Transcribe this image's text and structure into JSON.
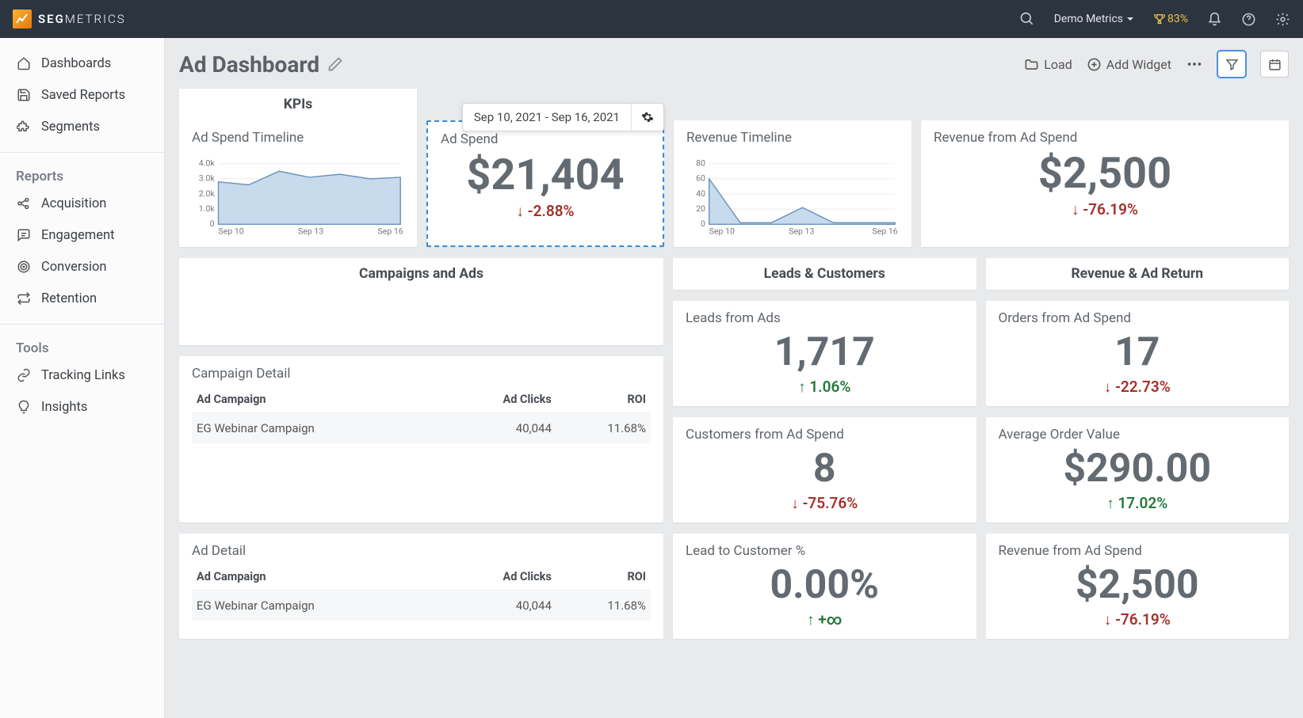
{
  "brand": {
    "seg": "SEG",
    "metrics": "METRICS"
  },
  "topbar": {
    "account": "Demo Metrics",
    "trophy_pct": "83%"
  },
  "sidebar": {
    "items_main": [
      {
        "label": "Dashboards"
      },
      {
        "label": "Saved Reports"
      },
      {
        "label": "Segments"
      }
    ],
    "reports_head": "Reports",
    "items_reports": [
      {
        "label": "Acquisition"
      },
      {
        "label": "Engagement"
      },
      {
        "label": "Conversion"
      },
      {
        "label": "Retention"
      }
    ],
    "tools_head": "Tools",
    "items_tools": [
      {
        "label": "Tracking Links"
      },
      {
        "label": "Insights"
      }
    ]
  },
  "page": {
    "title": "Ad Dashboard",
    "load": "Load",
    "add_widget": "Add Widget"
  },
  "kpis_label": "KPIs",
  "date_range": "Sep 10, 2021 - Sep 16, 2021",
  "ad_spend_timeline": {
    "title": "Ad Spend Timeline"
  },
  "ad_spend": {
    "title": "Ad Spend",
    "value": "$21,404",
    "delta": "↓ -2.88%"
  },
  "revenue_timeline": {
    "title": "Revenue Timeline"
  },
  "revenue_from_ad_spend": {
    "title": "Revenue from Ad Spend",
    "value": "$2,500",
    "delta": "↓ -76.19%"
  },
  "section_campaigns": "Campaigns and Ads",
  "section_leads": "Leads & Customers",
  "section_revret": "Revenue & Ad Return",
  "campaign_detail": {
    "title": "Campaign Detail",
    "cols": {
      "c1": "Ad Campaign",
      "c2": "Ad Clicks",
      "c3": "ROI"
    },
    "row": {
      "c1": "EG Webinar Campaign",
      "c2": "40,044",
      "c3": "11.68%"
    }
  },
  "ad_detail": {
    "title": "Ad Detail",
    "cols": {
      "c1": "Ad Campaign",
      "c2": "Ad Clicks",
      "c3": "ROI"
    },
    "row": {
      "c1": "EG Webinar Campaign",
      "c2": "40,044",
      "c3": "11.68%"
    }
  },
  "leads_from_ads": {
    "title": "Leads from Ads",
    "value": "1,717",
    "delta": "↑ 1.06%"
  },
  "customers_from_ad_spend": {
    "title": "Customers from Ad Spend",
    "value": "8",
    "delta": "↓ -75.76%"
  },
  "lead_to_customer": {
    "title": "Lead to Customer %",
    "value": "0.00%",
    "delta": "↑ +∞"
  },
  "orders_from_ad_spend": {
    "title": "Orders from Ad Spend",
    "value": "17",
    "delta": "↓ -22.73%"
  },
  "aov": {
    "title": "Average Order Value",
    "value": "$290.00",
    "delta": "↑ 17.02%"
  },
  "revenue_from_ad_spend2": {
    "title": "Revenue from Ad Spend",
    "value": "$2,500",
    "delta": "↓ -76.19%"
  },
  "chart_data": [
    {
      "type": "area",
      "title": "Ad Spend Timeline",
      "x": [
        "Sep 10",
        "Sep 11",
        "Sep 12",
        "Sep 13",
        "Sep 14",
        "Sep 15",
        "Sep 16"
      ],
      "values": [
        2800,
        2600,
        3500,
        3100,
        3300,
        3000,
        3100
      ],
      "ylim": [
        0,
        4000
      ],
      "yticks": [
        "0",
        "1.0k",
        "2.0k",
        "3.0k",
        "4.0k"
      ],
      "xticks": [
        "Sep 10",
        "Sep 13",
        "Sep 16"
      ]
    },
    {
      "type": "area",
      "title": "Revenue Timeline",
      "x": [
        "Sep 10",
        "Sep 11",
        "Sep 12",
        "Sep 13",
        "Sep 14",
        "Sep 15",
        "Sep 16"
      ],
      "values": [
        60,
        2,
        2,
        22,
        2,
        2,
        2
      ],
      "ylim": [
        0,
        80
      ],
      "yticks": [
        "0",
        "20",
        "40",
        "60",
        "80"
      ],
      "xticks": [
        "Sep 10",
        "Sep 13",
        "Sep 16"
      ]
    }
  ]
}
